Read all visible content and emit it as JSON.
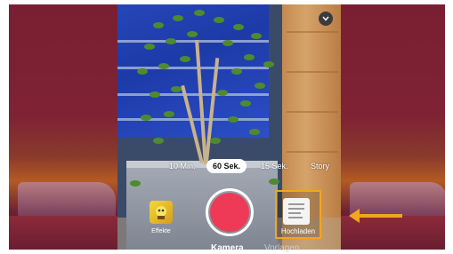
{
  "camera": {
    "durations": [
      {
        "label": "10 Min.",
        "selected": false
      },
      {
        "label": "60 Sek.",
        "selected": true
      },
      {
        "label": "15 Sek.",
        "selected": false
      },
      {
        "label": "Story",
        "selected": false
      }
    ],
    "effects_label": "Effekte",
    "upload_label": "Hochladen",
    "tabs": [
      {
        "label": "Kamera",
        "active": true
      },
      {
        "label": "Vorlagen",
        "active": false
      }
    ],
    "icons": {
      "collapse": "chevron-down-icon",
      "effects": "effects-thumbnail-icon",
      "record": "record-button-icon",
      "upload": "upload-thumbnail-icon",
      "annotation": "arrow-left-icon"
    },
    "colors": {
      "record": "#ef3a57",
      "highlight": "#f2a51f"
    }
  }
}
